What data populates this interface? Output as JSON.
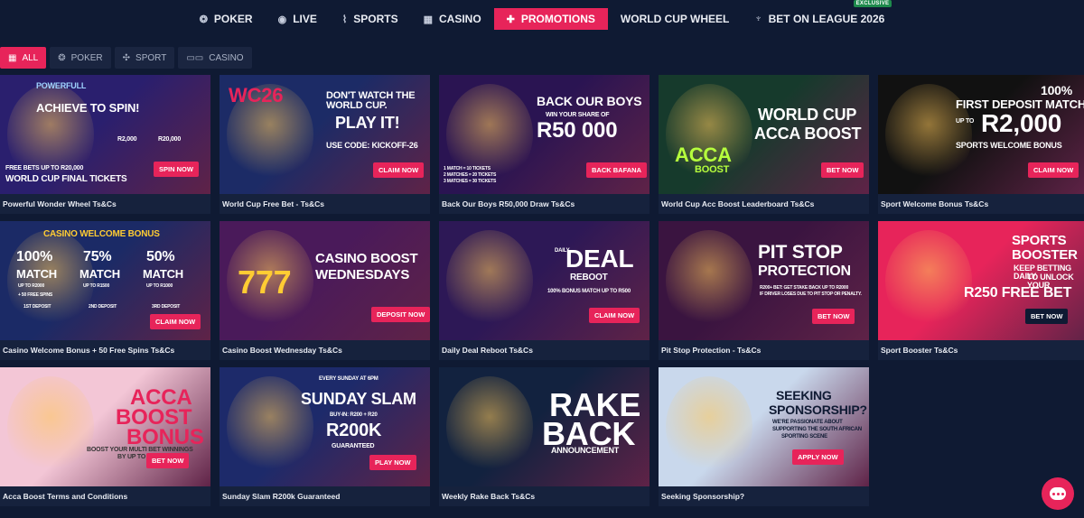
{
  "nav": {
    "items": [
      {
        "label": "POKER",
        "icon": "poker-chip-icon",
        "glyph": "❂"
      },
      {
        "label": "LIVE",
        "icon": "broadcast-icon",
        "glyph": "◉"
      },
      {
        "label": "SPORTS",
        "icon": "sports-icon",
        "glyph": "⌇"
      },
      {
        "label": "CASINO",
        "icon": "casino-icon",
        "glyph": "▦"
      },
      {
        "label": "PROMOTIONS",
        "icon": "gift-icon",
        "glyph": "✚",
        "active": true
      },
      {
        "label": "WORLD CUP WHEEL",
        "icon": "",
        "glyph": ""
      },
      {
        "label": "BET ON LEAGUE 2026",
        "icon": "trophy-icon",
        "glyph": "♆",
        "badge": "EXCLUSIVE"
      }
    ]
  },
  "filters": [
    {
      "label": "ALL",
      "icon": "grid-icon",
      "glyph": "▦",
      "active": true
    },
    {
      "label": "POKER",
      "icon": "poker-chip-icon",
      "glyph": "❂"
    },
    {
      "label": "SPORT",
      "icon": "sport-icon",
      "glyph": "✣"
    },
    {
      "label": "CASINO",
      "icon": "slot-icon",
      "glyph": "▭▭"
    }
  ],
  "promos": [
    {
      "caption": "Powerful Wonder Wheel Ts&Cs",
      "bg": "#2a1f6e",
      "accent": "#e7245a",
      "lines": [
        "POWERFULL",
        "ACHIEVE TO SPIN!",
        "R2,000",
        "R20,000",
        "FREE BETS UP TO R20,000",
        "WORLD CUP FINAL TICKETS"
      ],
      "button": "SPIN NOW"
    },
    {
      "caption": "World Cup Free Bet - Ts&Cs",
      "bg": "#1c2b66",
      "accent": "#e7245a",
      "lines": [
        "WC26",
        "DON'T WATCH THE WORLD CUP.",
        "PLAY IT!",
        "USE CODE: KICKOFF-26"
      ],
      "button": "CLAIM NOW"
    },
    {
      "caption": "Back Our Boys R50,000 Draw Ts&Cs",
      "bg": "#2a1452",
      "accent": "#e7245a",
      "lines": [
        "BACK OUR BOYS",
        "WIN YOUR SHARE OF",
        "R50 000",
        "1 MATCH = 10 TICKETS",
        "2 MATCHES = 20 TICKETS",
        "3 MATCHES = 30 TICKETS"
      ],
      "button": "BACK BAFANA"
    },
    {
      "caption": "World Cup Acc Boost Leaderboard Ts&Cs",
      "bg": "#163a2c",
      "accent": "#e7245a",
      "lines": [
        "WORLD CUP",
        "ACCA BOOST",
        "ACCA",
        "Boost"
      ],
      "button": "BET NOW"
    },
    {
      "caption": "Sport Welcome Bonus Ts&Cs",
      "bg": "#111111",
      "accent": "#e7245a",
      "lines": [
        "100%",
        "FIRST DEPOSIT MATCH",
        "UP TO",
        "R2,000",
        "SPORTS WELCOME BONUS"
      ],
      "button": "CLAIM NOW"
    },
    {
      "caption": "Casino Welcome Bonus + 50 Free Spins Ts&Cs",
      "bg": "#1b2a66",
      "accent": "#e7245a",
      "lines": [
        "Casino Welcome Bonus",
        "100%",
        "MATCH",
        "UP TO R2000",
        "75%",
        "MATCH",
        "UP TO R1500",
        "50%",
        "MATCH",
        "UP TO R1000",
        "+ 50 Free Spins",
        "1st Deposit",
        "2nd Deposit",
        "3rd Deposit"
      ],
      "button": "CLAIM NOW"
    },
    {
      "caption": "Casino Boost Wednesday Ts&Cs",
      "bg": "#4a1a5a",
      "accent": "#e7245a",
      "lines": [
        "CASINO BOOST",
        "WEDNESDAYS",
        "777"
      ],
      "button": "DEPOSIT NOW"
    },
    {
      "caption": "Daily Deal Reboot Ts&Cs",
      "bg": "#2d1856",
      "accent": "#e7245a",
      "lines": [
        "DAILY",
        "DEAL",
        "REBOOT",
        "100% BONUS MATCH UP TO R500"
      ],
      "button": "CLAIM NOW"
    },
    {
      "caption": "Pit Stop Protection - Ts&Cs",
      "bg": "#3a1440",
      "accent": "#e7245a",
      "lines": [
        "PIT STOP",
        "PROTECTION",
        "R200+ Bet: Get Stake Back up to R2000",
        "if Driver Loses Due to Pit Stop or Penalty."
      ],
      "button": "BET NOW"
    },
    {
      "caption": "Sport Booster Ts&Cs",
      "bg": "#e7245a",
      "accent": "#ffffff",
      "lines": [
        "SPORTS",
        "BOOSTER",
        "Keep betting daily",
        "to unlock your",
        "R250 Free Bet"
      ],
      "button": "BET NOW"
    },
    {
      "caption": "Acca Boost Terms and Conditions",
      "bg": "#f3c6d6",
      "accent": "#e7245a",
      "lines": [
        "ACCA",
        "BOOST",
        "BONUS",
        "Boost your multi bet winnings",
        "by up to 300%"
      ],
      "button": "BET NOW"
    },
    {
      "caption": "Sunday Slam R200k Guaranteed",
      "bg": "#1d2a6a",
      "accent": "#e7245a",
      "lines": [
        "EVERY SUNDAY AT 6PM",
        "SUNDAY SLAM",
        "BUY-IN: R200 + R20",
        "R200K",
        "GUARANTEED"
      ],
      "button": "PLAY NOW"
    },
    {
      "caption": "Weekly Rake Back Ts&Cs",
      "bg": "#12223f",
      "accent": "#e7245a",
      "lines": [
        "RAKE",
        "BACK",
        "ANNOUNCEMENT"
      ],
      "button": ""
    },
    {
      "caption": "Seeking Sponsorship?",
      "bg": "#c9d8ec",
      "accent": "#e7245a",
      "lines": [
        "SEEKING",
        "SPONSORSHIP?",
        "We're passionate about",
        "supporting the South African",
        "sporting scene"
      ],
      "button": "Apply Now"
    }
  ],
  "chat": {
    "icon": "chat-icon"
  }
}
